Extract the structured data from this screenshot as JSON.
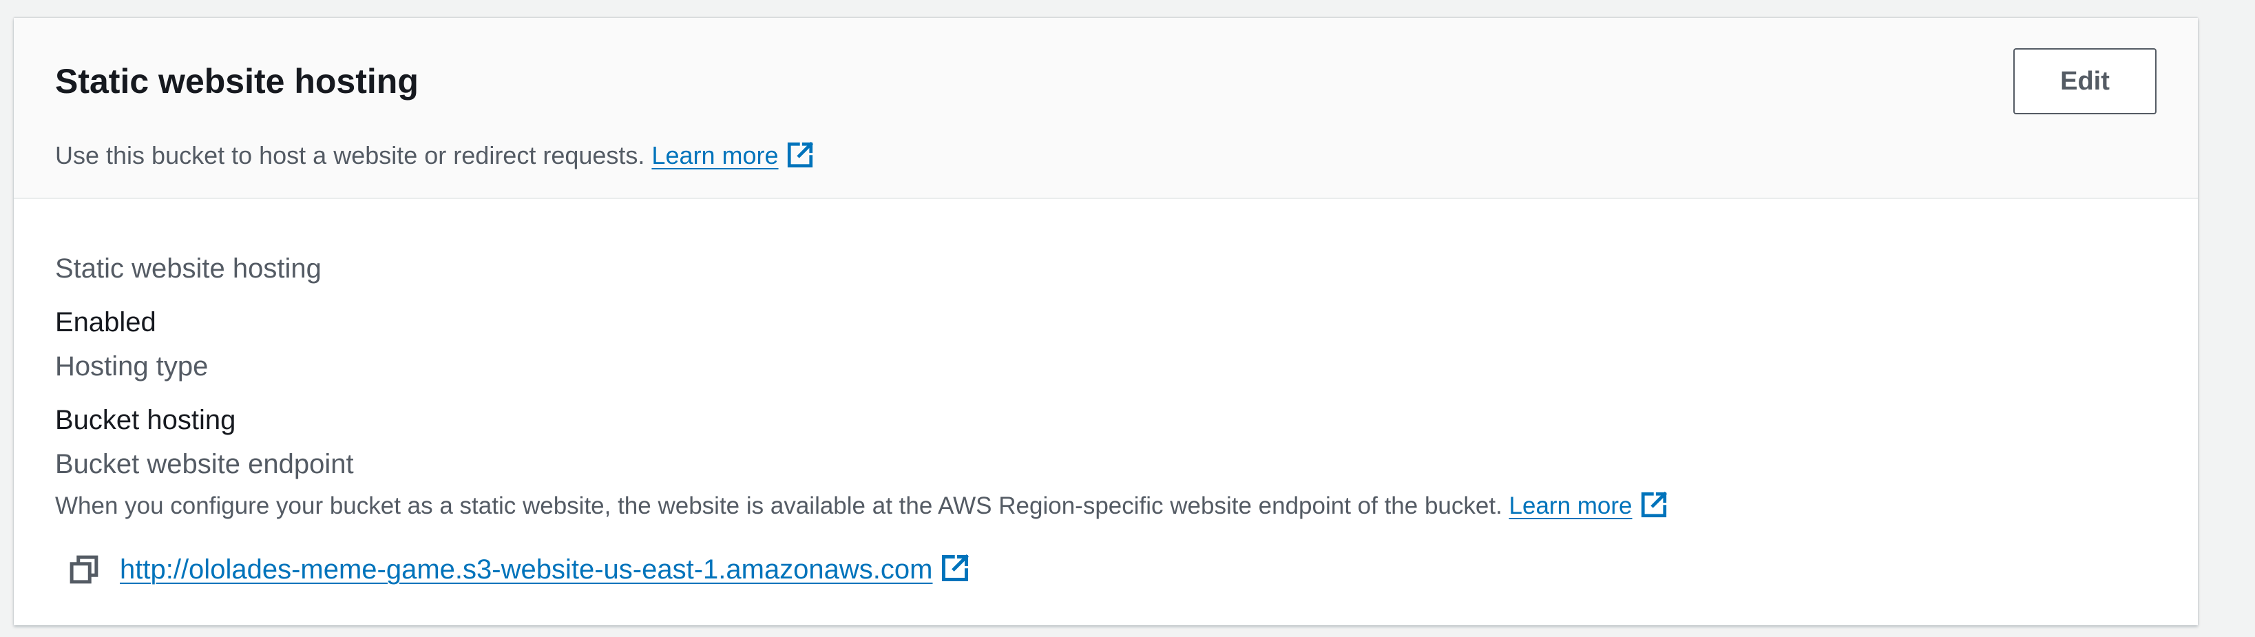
{
  "header": {
    "title": "Static website hosting",
    "description": "Use this bucket to host a website or redirect requests.",
    "learn_more": "Learn more",
    "edit_label": "Edit"
  },
  "details": {
    "hosting_label": "Static website hosting",
    "hosting_value": "Enabled",
    "type_label": "Hosting type",
    "type_value": "Bucket hosting",
    "endpoint_label": "Bucket website endpoint",
    "endpoint_hint": "When you configure your bucket as a static website, the website is available at the AWS Region-specific website endpoint of the bucket.",
    "endpoint_learn_more": "Learn more",
    "endpoint_url": "http://ololades-meme-game.s3-website-us-east-1.amazonaws.com"
  },
  "icons": {
    "external_link": "external-link-icon",
    "copy": "copy-icon"
  },
  "colors": {
    "link": "#0073bb",
    "heading": "#16191f",
    "secondary_text": "#545b64",
    "header_bg": "#fafafa"
  }
}
